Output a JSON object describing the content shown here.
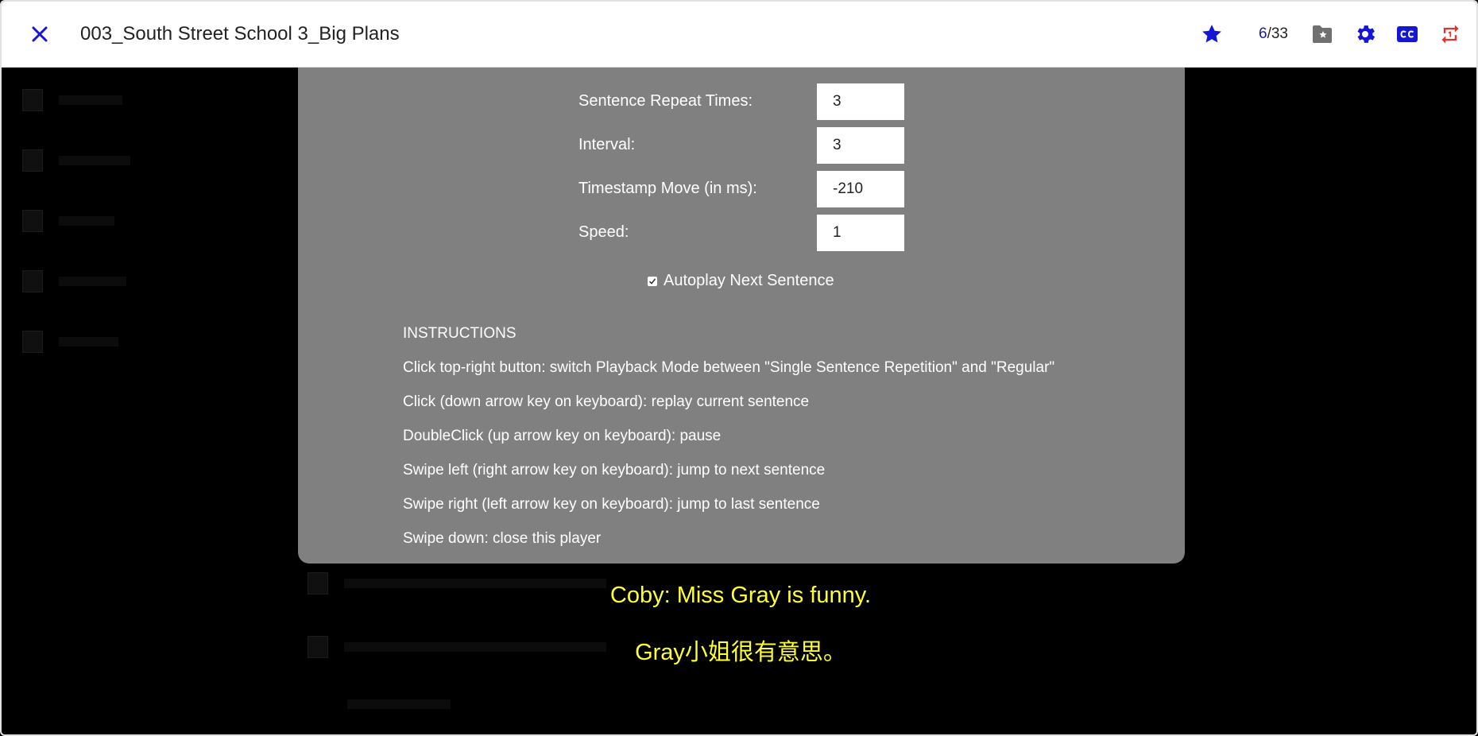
{
  "header": {
    "title": "003_South Street School 3_Big Plans",
    "counter_current": "6",
    "counter_total": "/33",
    "icons": {
      "close": "close-icon",
      "favorite": "star-icon",
      "folder": "folder-star-icon",
      "settings": "gear-icon",
      "subtitles": "closed-caption-icon",
      "repeat_mode": "repeat-one-icon"
    }
  },
  "settings": {
    "repeat_label": "Sentence Repeat Times:",
    "repeat_value": "3",
    "interval_label": "Interval:",
    "interval_value": "3",
    "timestamp_label": "Timestamp Move (in ms):",
    "timestamp_value": "-210",
    "speed_label": "Speed:",
    "speed_value": "1",
    "autoplay_label": "Autoplay Next Sentence",
    "autoplay_checked": true
  },
  "instructions": {
    "heading": "INSTRUCTIONS",
    "lines": [
      "Click top-right button: switch Playback Mode between \"Single Sentence Repetition\" and \"Regular\"",
      "Click (down arrow key on keyboard): replay current sentence",
      "DoubleClick (up arrow key on keyboard): pause",
      "Swipe left (right arrow key on keyboard): jump to next sentence",
      "Swipe right (left arrow key on keyboard): jump to last sentence",
      "Swipe down: close this player"
    ]
  },
  "subtitles": {
    "english": "Coby: Miss Gray is funny.",
    "chinese": "Gray小姐很有意思。"
  },
  "colors": {
    "accent_blue": "#1515d6",
    "repeat_red": "#e53030",
    "folder_gray": "#707070",
    "panel_gray": "#808080",
    "subtitle_yellow": "#ffff33"
  }
}
